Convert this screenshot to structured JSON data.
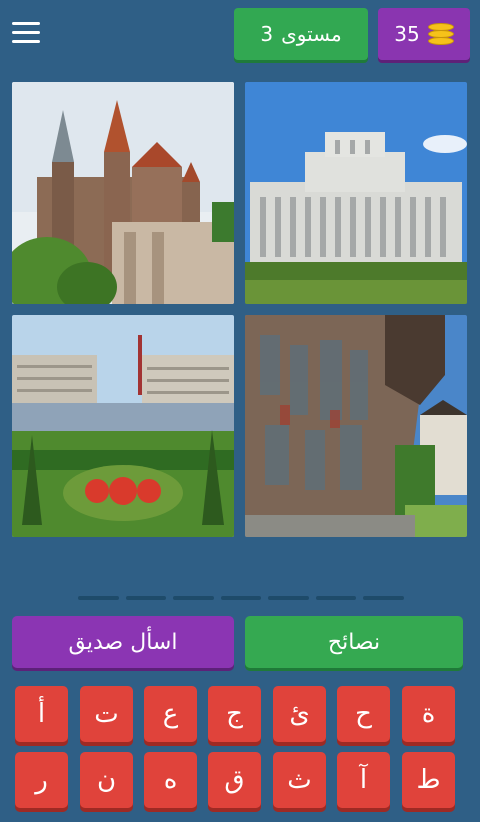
{
  "header": {
    "menu_icon": "hamburger-icon",
    "level_label": "مستوى",
    "level_number": "3",
    "coins": "35",
    "coin_icon": "coin-stack-icon",
    "level_color": "#32a852",
    "coins_color": "#8a35b0"
  },
  "images": [
    {
      "id": "castle",
      "icon": "castle-photo"
    },
    {
      "id": "palace",
      "icon": "palace-photo"
    },
    {
      "id": "boulevard",
      "icon": "city-square-photo"
    },
    {
      "id": "monastery",
      "icon": "painted-wall-photo"
    }
  ],
  "answer_slots": 7,
  "actions": {
    "ask_friend": "اسأل صديق",
    "hints": "نصائح"
  },
  "keyboard": {
    "row1": [
      "أ",
      "ت",
      "ع",
      "ج",
      "ئ",
      "ح",
      "ة"
    ],
    "row2": [
      "ر",
      "ن",
      "ه",
      "ق",
      "ث",
      "آ",
      "ط"
    ]
  },
  "colors": {
    "background": "#2f5f86",
    "key": "#e0433b",
    "friend_button": "#8b35b3",
    "hints_button": "#35a951"
  }
}
